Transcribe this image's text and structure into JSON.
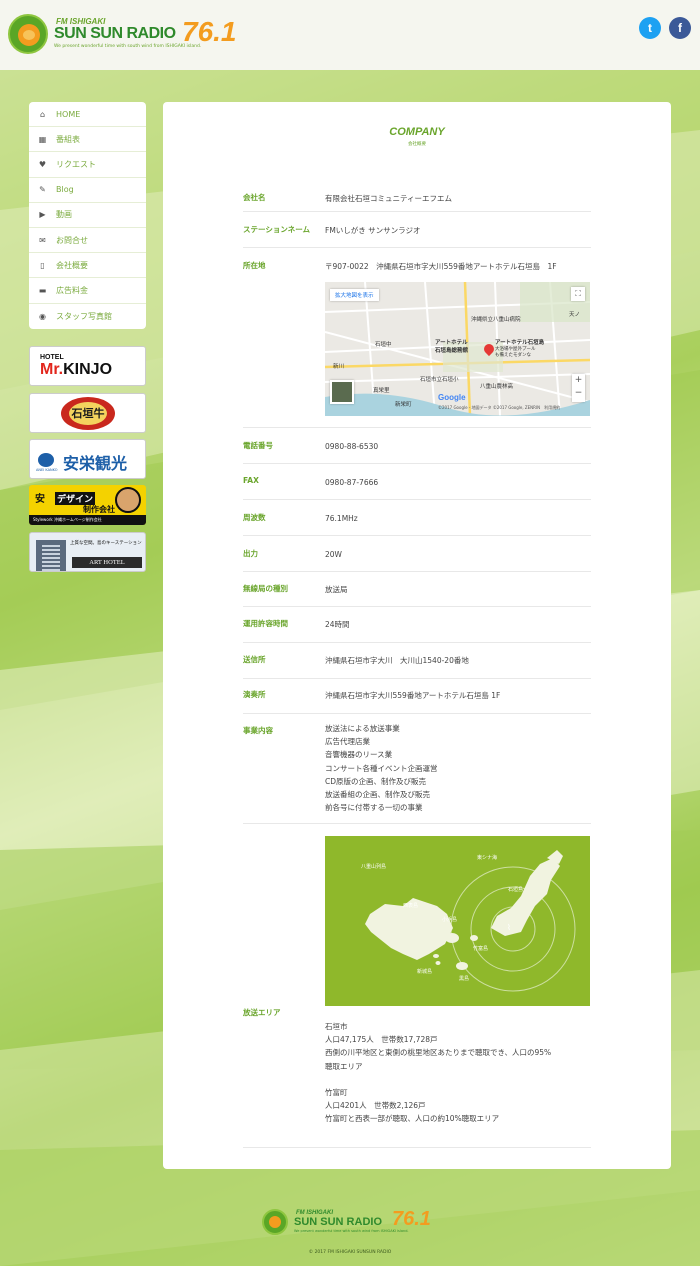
{
  "header": {
    "logo_fm": "FM ISHIGAKI",
    "logo_main": "SUN SUN RADIO",
    "logo_freq": "76.1",
    "logo_tagline": "We present wonderful time with south wind from ISHIGAKI island.",
    "twitter_glyph": "t",
    "facebook_glyph": "f"
  },
  "sidebar": {
    "items": [
      {
        "label": "HOME",
        "icon": "home-icon",
        "glyph": "⌂"
      },
      {
        "label": "番組表",
        "icon": "calendar-icon",
        "glyph": "▦"
      },
      {
        "label": "リクエスト",
        "icon": "heart-icon",
        "glyph": "♥"
      },
      {
        "label": "Blog",
        "icon": "pencil-icon",
        "glyph": "✎"
      },
      {
        "label": "動画",
        "icon": "play-icon",
        "glyph": "▶"
      },
      {
        "label": "お問合せ",
        "icon": "mail-icon",
        "glyph": "✉"
      },
      {
        "label": "会社概要",
        "icon": "phone-icon",
        "glyph": "▯"
      },
      {
        "label": "広告料金",
        "icon": "money-icon",
        "glyph": "▬"
      },
      {
        "label": "スタッフ写真館",
        "icon": "camera-icon",
        "glyph": "◉"
      }
    ]
  },
  "banners": {
    "kinjo_small": "HOTEL",
    "kinjo_big_mr": "Mr.",
    "kinjo_big_name": "KINJO",
    "ishigaki_beef": "石垣牛",
    "anei_small": "ANEI KANKO",
    "anei": "安栄観光",
    "stylewk_t1": "安",
    "stylewk_t2": "デザイン",
    "stylewk_t3": "制作会社",
    "stylewk_bar": "Stylework 沖縄ホームページ制作会社",
    "arthotel_t1": "上質な空間。島のキーステーション",
    "arthotel_t2": "ART HOTEL"
  },
  "main": {
    "title": "COMPANY",
    "subtitle": "会社概要",
    "rows": [
      {
        "label": "会社名",
        "value": [
          "有限会社石垣コミュニティーエフエム"
        ]
      },
      {
        "label": "ステーションネーム",
        "value": [
          "FMいしがき サンサンラジオ"
        ]
      },
      {
        "label": "所在地",
        "value": [
          "〒907-0022　沖縄県石垣市字大川559番地アートホテル石垣島　1F"
        ]
      },
      {
        "label": "電話番号",
        "value": [
          "0980-88-6530"
        ]
      },
      {
        "label": "FAX",
        "value": [
          "0980-87-7666"
        ]
      },
      {
        "label": "周波数",
        "value": [
          "76.1MHz"
        ]
      },
      {
        "label": "出力",
        "value": [
          "20W"
        ]
      },
      {
        "label": "無線局の種別",
        "value": [
          "放送局"
        ]
      },
      {
        "label": "運用許容時間",
        "value": [
          "24時間"
        ]
      },
      {
        "label": "送信所",
        "value": [
          "沖縄県石垣市字大川　大川山1540-20番地"
        ]
      },
      {
        "label": "演奏所",
        "value": [
          "沖縄県石垣市字大川559番地アートホテル石垣島 1F"
        ]
      },
      {
        "label": "事業内容",
        "value": [
          "放送法による放送事業",
          "広告代理店業",
          "音響機器のリース業",
          "コンサート各種イベント企画運営",
          "CD原版の企画、制作及び販売",
          "放送番組の企画、制作及び販売",
          "前各号に付帯する一切の事業"
        ]
      },
      {
        "label": "放送エリア",
        "value": [
          "石垣市",
          "人口47,175人　世帯数17,728戸",
          "西側の川平地区と東側の桃里地区あたりまで聴取でき、人口の95%",
          "聴取エリア",
          "",
          "竹富町",
          "人口4201人　世帯数2,126戸",
          "竹富町と西表一部が聴取、人口の約10%聴取エリア"
        ]
      }
    ],
    "map": {
      "enlarge_label": "拡大地図を表示",
      "hotel_name": "アートホテル",
      "hotel_name2": "石垣島",
      "hotel_full": "アートホテル石垣島",
      "hotel_desc1": "大浴場や屋外プール",
      "hotel_desc2": "も備えたモダンな",
      "hospital": "沖縄県立八重山病院",
      "school": "石垣中",
      "school2": "石垣市立石垣小",
      "bank": "八重山農林高",
      "city": "石垣",
      "ishigaki_hall": "石垣島総務舘",
      "kawa": "新栄町",
      "kawa2": "新川",
      "ten": "天ノ",
      "kohama": "真栄里",
      "google": "Google",
      "copyright": "©2017 Google - 地図データ ©2017 Google, ZENRIN　利用規約"
    },
    "area_map": {
      "yaeyama": "八重山列島",
      "east": "東シナ海",
      "ishigaki": "石垣島",
      "iriomote": "西表島",
      "kohama": "小浜島",
      "taketomi": "竹富島",
      "aragusuku": "新城島",
      "kuroshima": "黒島"
    }
  },
  "footer": {
    "logo_fm": "FM ISHIGAKI",
    "logo_main": "SUN SUN RADIO",
    "logo_freq": "76.1",
    "logo_tagline": "We present wonderful time with south wind from ISHIGAKI island.",
    "copyright": "© 2017 FM ISHIGAKI SUNSUN RADIO"
  }
}
